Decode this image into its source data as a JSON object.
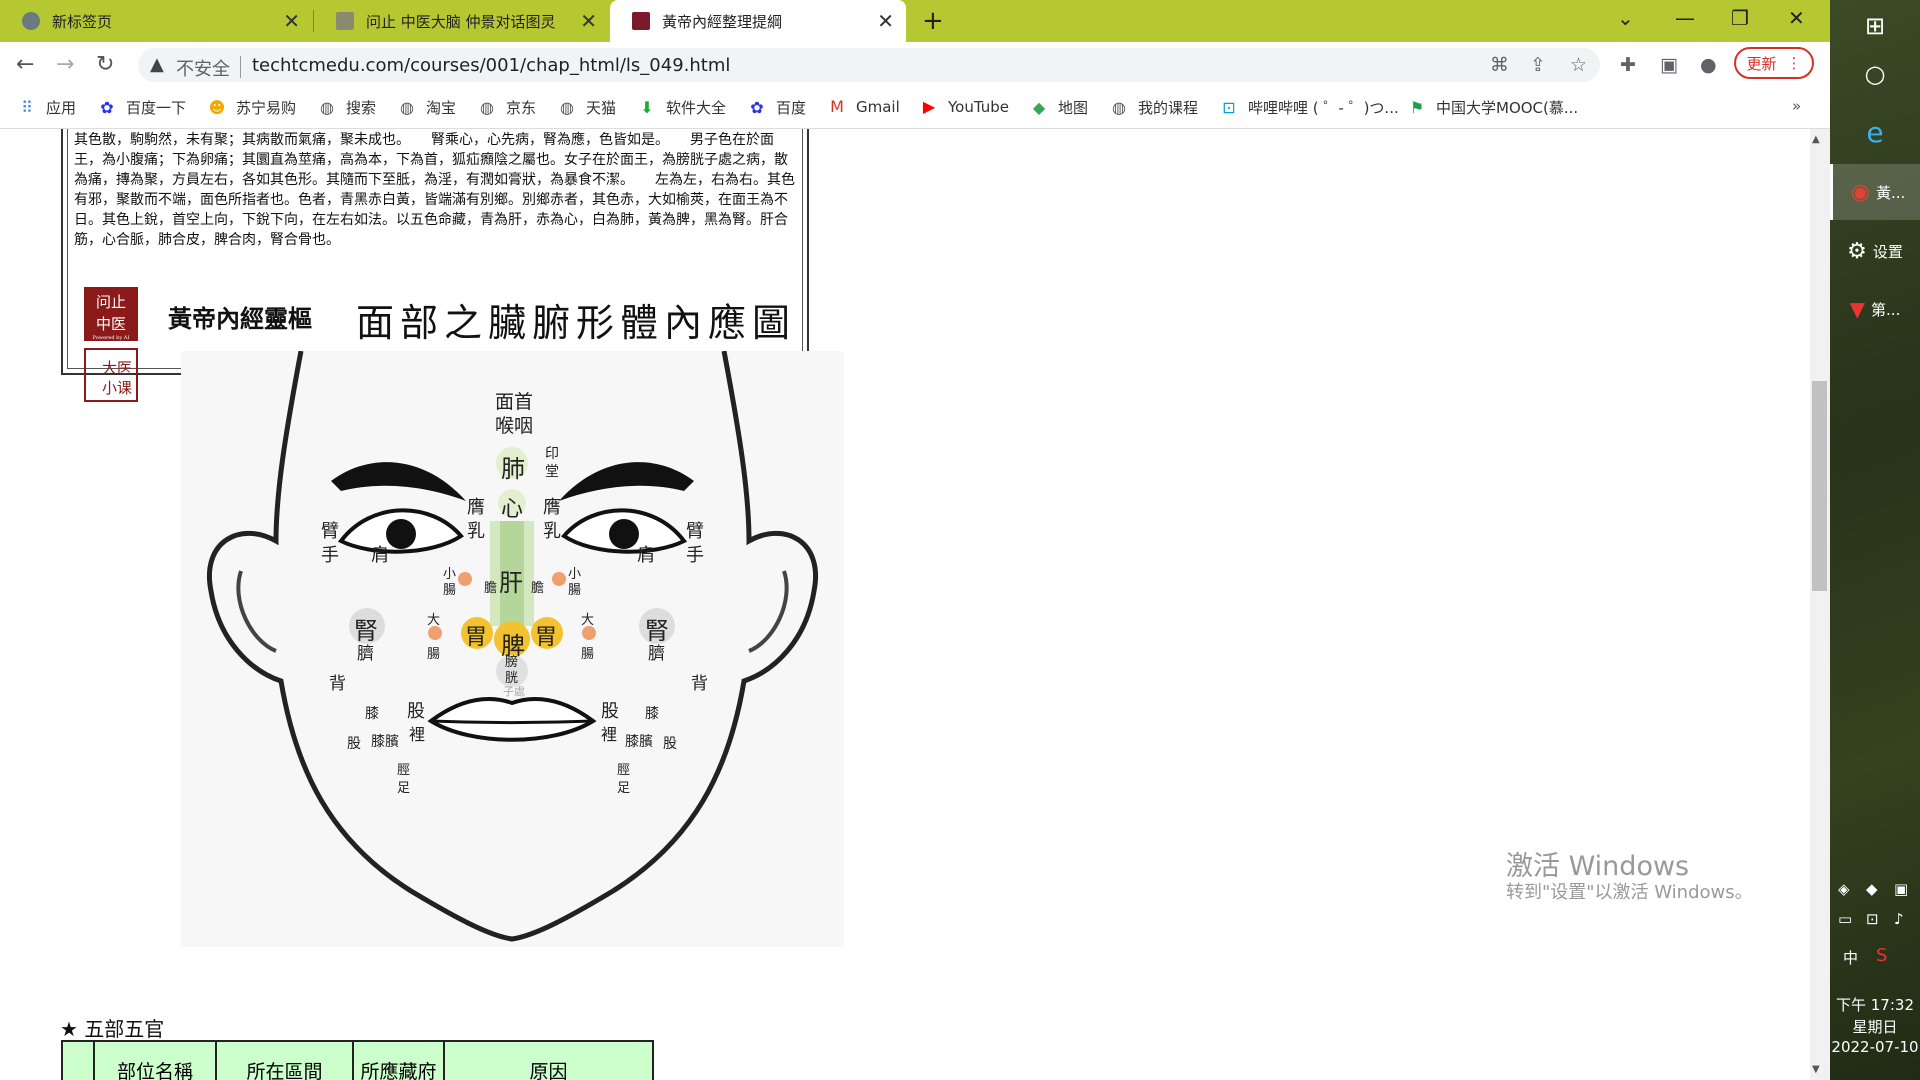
{
  "tabs": [
    {
      "title": "新标签页",
      "icon": "globe-icon",
      "active": false
    },
    {
      "title": "问止 中医大脑 仲景对话图灵",
      "icon": "site-favicon-icon",
      "active": false
    },
    {
      "title": "黃帝內經整理提綱",
      "icon": "book-favicon-icon",
      "active": true
    }
  ],
  "toolbar": {
    "insecure_label": "不安全",
    "url": "techtcmedu.com/courses/001/chap_html/ls_049.html",
    "update_label": "更新"
  },
  "bookmarks": [
    {
      "label": "应用",
      "icon": "apps-grid-icon"
    },
    {
      "label": "百度一下",
      "icon": "baidu-paw-icon"
    },
    {
      "label": "苏宁易购",
      "icon": "suning-icon"
    },
    {
      "label": "搜索",
      "icon": "globe-icon"
    },
    {
      "label": "淘宝",
      "icon": "globe-icon"
    },
    {
      "label": "京东",
      "icon": "globe-icon"
    },
    {
      "label": "天猫",
      "icon": "globe-icon"
    },
    {
      "label": "软件大全",
      "icon": "download-icon"
    },
    {
      "label": "百度",
      "icon": "baidu-paw-icon"
    },
    {
      "label": "Gmail",
      "icon": "gmail-icon"
    },
    {
      "label": "YouTube",
      "icon": "youtube-icon"
    },
    {
      "label": "地图",
      "icon": "maps-icon"
    },
    {
      "label": "我的课程",
      "icon": "globe-icon"
    },
    {
      "label": "哔哩哔哩 ( ゜- ゜)つ...",
      "icon": "bilibili-icon"
    },
    {
      "label": "中国大学MOOC(慕...",
      "icon": "mooc-icon"
    }
  ],
  "article": {
    "paragraph": "其色散，駒駒然，未有聚；其病散而氣痛，聚未成也。　　腎乘心，心先病，腎為應，色皆如是。　　男子色在於面王，為小腹痛；下為卵痛；其圜直為莖痛，高為本，下為首，狐疝㿗陰之屬也。女子在於面王，為膀胱子處之病，散為痛，摶為聚，方員左右，各如其色形。其隨而下至胝，為淫，有潤如膏狀，為暴食不潔。　　左為左，右為右。其色有邪，聚散而不端，面色所指者也。色者，青黑赤白黃，皆端滿有別鄉。別鄉赤者，其色赤，大如榆莢，在面王為不日。其色上銳，首空上向，下銳下向，在左右如法。以五色命藏，青為肝，赤為心，白為肺，黃為脾，黑為腎。肝合筋，心合脈，肺合皮，脾合肉，腎合骨也。",
    "logo1_lines": [
      "问止",
      "中医"
    ],
    "logo1_small": "Powered by AI",
    "logo2_lines": [
      "大医",
      "小课"
    ],
    "figure_series": "黃帝內經靈樞",
    "figure_title": "面部之臟腑形體內應圖",
    "face_labels": {
      "face_head": [
        "面首"
      ],
      "throat": [
        "喉咽"
      ],
      "lung": "肺",
      "yintang": [
        "印",
        "堂"
      ],
      "heart": "心",
      "breast_l": [
        "膺",
        "乳"
      ],
      "breast_r": [
        "膺",
        "乳"
      ],
      "liver": "肝",
      "gallbladder_l": "膽",
      "gallbladder_r": "膽",
      "spleen": "脾",
      "stomach_l": "胃",
      "stomach_r": "胃",
      "bladder": [
        "膀",
        "胱"
      ],
      "zichu": [
        "子",
        "處"
      ],
      "arm_hand_l": [
        "臂",
        "手"
      ],
      "arm_hand_r": [
        "臂",
        "手"
      ],
      "shoulder_l": "肩",
      "shoulder_r": "肩",
      "small_intestine_l": [
        "小",
        "腸"
      ],
      "small_intestine_r": [
        "小",
        "腸"
      ],
      "large_intestine_l": [
        "大",
        "腸"
      ],
      "large_intestine_r": [
        "大",
        "腸"
      ],
      "kidney_l": "腎",
      "kidney_r": "腎",
      "navel_l": "臍",
      "navel_r": "臍",
      "back_l": "背",
      "back_r": "背",
      "thigh_l": "股",
      "thigh_r": "股",
      "inner_l": "裡",
      "inner_r": "裡",
      "knee_l": "膝",
      "knee_r": "膝",
      "kneecap_l": "膝臏",
      "kneecap_r": "膝臏",
      "thigh2_l": "股",
      "thigh2_r": "股",
      "shin_foot_l": [
        "脛",
        "足"
      ],
      "shin_foot_r": [
        "脛",
        "足"
      ]
    },
    "section_title": "★ 五部五官",
    "table_headers": [
      "",
      "部位名稱",
      "所在區間",
      "所應藏府",
      "原因"
    ]
  },
  "watermark": {
    "line1": "激活 Windows",
    "line2": "转到\"设置\"以激活 Windows。"
  },
  "taskbar": {
    "items": [
      {
        "label": "",
        "icon": "windows-start-icon"
      },
      {
        "label": "",
        "icon": "cortana-circle-icon"
      },
      {
        "label": "",
        "icon": "ie-icon"
      },
      {
        "label": "黃...",
        "icon": "chrome-icon",
        "active": true
      },
      {
        "label": "设置",
        "icon": "gear-icon"
      },
      {
        "label": "第...",
        "icon": "app-icon"
      }
    ],
    "ime": "中",
    "time": "下午 17:32",
    "weekday": "星期日",
    "date": "2022-07-10"
  },
  "colors": {
    "tabstrip": "#b5c832",
    "taskbar": "#2d3a1c",
    "logo_red": "#8b1a1a",
    "table_green": "#ccffcc",
    "update_red": "#d93025"
  }
}
